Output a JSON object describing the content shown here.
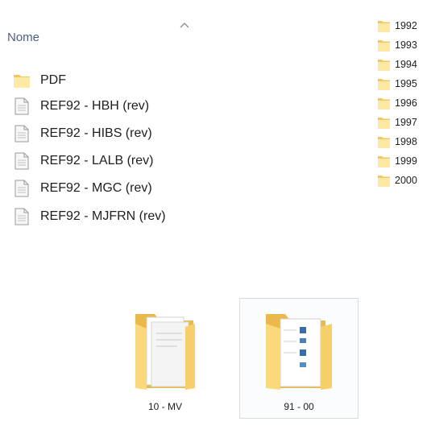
{
  "list": {
    "column_header": "Nome",
    "items": [
      {
        "label": "PDF",
        "icon": "folder-icon"
      },
      {
        "label": "REF92 - HBH (rev)",
        "icon": "document-icon"
      },
      {
        "label": "REF92 - HIBS (rev)",
        "icon": "document-icon"
      },
      {
        "label": "REF92 - LALB (rev)",
        "icon": "document-icon"
      },
      {
        "label": "REF92 - MGC (rev)",
        "icon": "document-icon"
      },
      {
        "label": "REF92 - MJFRN (rev)",
        "icon": "document-icon"
      }
    ]
  },
  "years": {
    "items": [
      "1992",
      "1993",
      "1994",
      "1995",
      "1996",
      "1997",
      "1998",
      "1999",
      "2000"
    ]
  },
  "large_icons": [
    {
      "label": "10 - MV",
      "icon": "folder-with-documents-icon",
      "selected": false
    },
    {
      "label": "91 - 00",
      "icon": "folder-with-documents-icon",
      "selected": true
    }
  ],
  "colors": {
    "folder_light": "#fde9a3",
    "folder_dark": "#f2c65c",
    "header_text": "#4d6082",
    "selection_border": "#d3dbe3"
  }
}
